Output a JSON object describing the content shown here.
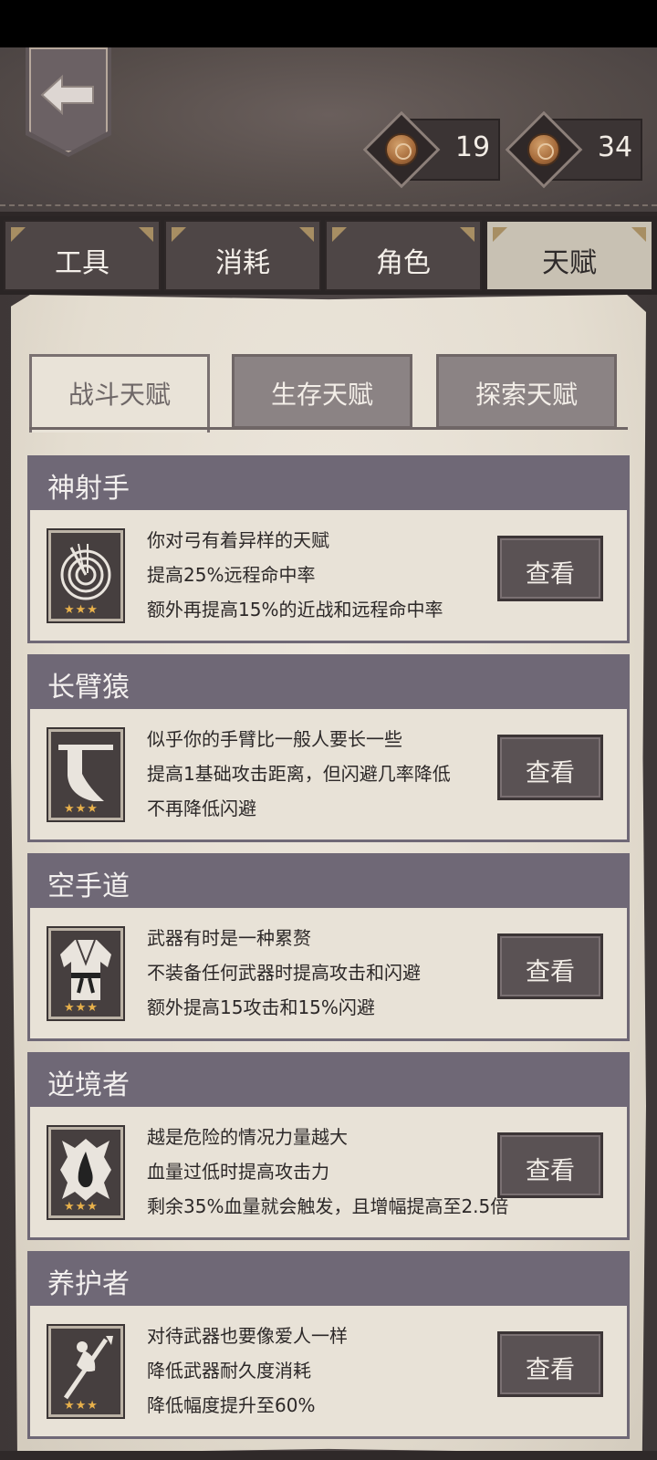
{
  "header": {
    "back_icon": "back-arrow-icon",
    "currencies": [
      {
        "icon": "coin-icon",
        "value": "19"
      },
      {
        "icon": "coin-icon",
        "value": "34"
      }
    ]
  },
  "tabs": [
    {
      "label": "工具",
      "active": false
    },
    {
      "label": "消耗",
      "active": false
    },
    {
      "label": "角色",
      "active": false
    },
    {
      "label": "天赋",
      "active": true
    }
  ],
  "subtabs": [
    {
      "label": "战斗天赋",
      "active": true
    },
    {
      "label": "生存天赋",
      "active": false
    },
    {
      "label": "探索天赋",
      "active": false
    }
  ],
  "talents": [
    {
      "title": "神射手",
      "icon": "target-arrow-icon",
      "stars": "★★★",
      "lines": [
        "你对弓有着异样的天赋",
        "提高25%远程命中率",
        "额外再提高15%的近战和远程命中率"
      ],
      "button": "查看"
    },
    {
      "title": "长臂猿",
      "icon": "long-arm-icon",
      "stars": "★★★",
      "lines": [
        "似乎你的手臂比一般人要长一些",
        "提高1基础攻击距离，但闪避几率降低",
        "不再降低闪避"
      ],
      "button": "查看"
    },
    {
      "title": "空手道",
      "icon": "karate-gi-icon",
      "stars": "★★★",
      "lines": [
        "武器有时是一种累赘",
        "不装备任何武器时提高攻击和闪避",
        "额外提高15攻击和15%闪避"
      ],
      "button": "查看"
    },
    {
      "title": "逆境者",
      "icon": "blood-drop-icon",
      "stars": "★★★",
      "lines": [
        "越是危险的情况力量越大",
        "血量过低时提高攻击力",
        "剩余35%血量就会触发，且增幅提高至2.5倍"
      ],
      "button": "查看"
    },
    {
      "title": "养护者",
      "icon": "spear-care-icon",
      "stars": "★★★",
      "lines": [
        "对待武器也要像爱人一样",
        "降低武器耐久度消耗",
        "降低幅度提升至60%"
      ],
      "button": "查看"
    }
  ]
}
